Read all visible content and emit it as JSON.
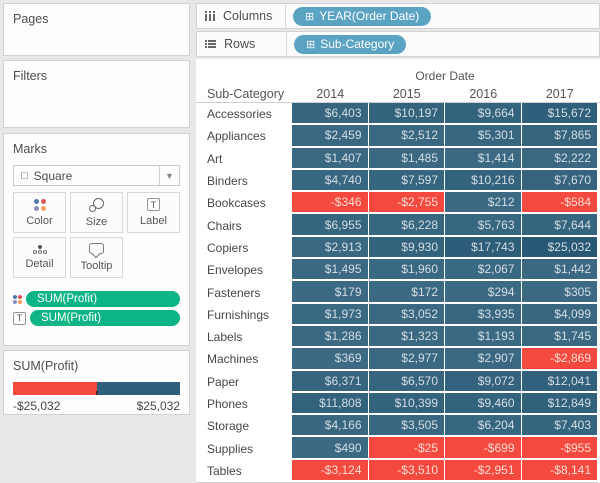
{
  "colors": {
    "pill_blue": "#5ba3c2",
    "pill_green": "#0db485",
    "cell_negative": "#f4493e",
    "cell_positive_low": "#3c6a84",
    "cell_positive_high": "#285875",
    "legend_red": "#f4493e",
    "legend_blue": "#2f5f7c"
  },
  "glyphs": {
    "square": "□",
    "caret": "▼",
    "field_plus": "⊞",
    "t": "T"
  },
  "shelves": {
    "columns_label": "Columns",
    "columns_pill": "YEAR(Order Date)",
    "rows_label": "Rows",
    "rows_pill": "Sub-Category"
  },
  "sidebar": {
    "pages_label": "Pages",
    "filters_label": "Filters",
    "marks": {
      "label": "Marks",
      "mark_type": "Square",
      "buttons": [
        "Color",
        "Size",
        "Label",
        "Detail",
        "Tooltip"
      ],
      "pills": [
        "SUM(Profit)",
        "SUM(Profit)"
      ]
    },
    "legend": {
      "title": "SUM(Profit)",
      "min_label": "-$25,032",
      "max_label": "$25,032"
    }
  },
  "chart_data": {
    "type": "heatmap",
    "title": "Order Date",
    "row_field": "Sub-Category",
    "columns": [
      "2014",
      "2015",
      "2016",
      "2017"
    ],
    "color_domain": [
      -25032,
      25032
    ],
    "legend_position": "left-bottom",
    "rows": [
      {
        "label": "Accessories",
        "values": [
          6403,
          10197,
          9664,
          15672
        ],
        "formatted": [
          "$6,403",
          "$10,197",
          "$9,664",
          "$15,672"
        ]
      },
      {
        "label": "Appliances",
        "values": [
          2459,
          2512,
          5301,
          7865
        ],
        "formatted": [
          "$2,459",
          "$2,512",
          "$5,301",
          "$7,865"
        ]
      },
      {
        "label": "Art",
        "values": [
          1407,
          1485,
          1414,
          2222
        ],
        "formatted": [
          "$1,407",
          "$1,485",
          "$1,414",
          "$2,222"
        ]
      },
      {
        "label": "Binders",
        "values": [
          4740,
          7597,
          10216,
          7670
        ],
        "formatted": [
          "$4,740",
          "$7,597",
          "$10,216",
          "$7,670"
        ]
      },
      {
        "label": "Bookcases",
        "values": [
          -346,
          -2755,
          212,
          -584
        ],
        "formatted": [
          "-$346",
          "-$2,755",
          "$212",
          "-$584"
        ]
      },
      {
        "label": "Chairs",
        "values": [
          6955,
          6228,
          5763,
          7644
        ],
        "formatted": [
          "$6,955",
          "$6,228",
          "$5,763",
          "$7,644"
        ]
      },
      {
        "label": "Copiers",
        "values": [
          2913,
          9930,
          17743,
          25032
        ],
        "formatted": [
          "$2,913",
          "$9,930",
          "$17,743",
          "$25,032"
        ]
      },
      {
        "label": "Envelopes",
        "values": [
          1495,
          1960,
          2067,
          1442
        ],
        "formatted": [
          "$1,495",
          "$1,960",
          "$2,067",
          "$1,442"
        ]
      },
      {
        "label": "Fasteners",
        "values": [
          179,
          172,
          294,
          305
        ],
        "formatted": [
          "$179",
          "$172",
          "$294",
          "$305"
        ]
      },
      {
        "label": "Furnishings",
        "values": [
          1973,
          3052,
          3935,
          4099
        ],
        "formatted": [
          "$1,973",
          "$3,052",
          "$3,935",
          "$4,099"
        ]
      },
      {
        "label": "Labels",
        "values": [
          1286,
          1323,
          1193,
          1745
        ],
        "formatted": [
          "$1,286",
          "$1,323",
          "$1,193",
          "$1,745"
        ]
      },
      {
        "label": "Machines",
        "values": [
          369,
          2977,
          2907,
          -2869
        ],
        "formatted": [
          "$369",
          "$2,977",
          "$2,907",
          "-$2,869"
        ]
      },
      {
        "label": "Paper",
        "values": [
          6371,
          6570,
          9072,
          12041
        ],
        "formatted": [
          "$6,371",
          "$6,570",
          "$9,072",
          "$12,041"
        ]
      },
      {
        "label": "Phones",
        "values": [
          11808,
          10399,
          9460,
          12849
        ],
        "formatted": [
          "$11,808",
          "$10,399",
          "$9,460",
          "$12,849"
        ]
      },
      {
        "label": "Storage",
        "values": [
          4166,
          3505,
          6204,
          7403
        ],
        "formatted": [
          "$4,166",
          "$3,505",
          "$6,204",
          "$7,403"
        ]
      },
      {
        "label": "Supplies",
        "values": [
          490,
          -25,
          -699,
          -955
        ],
        "formatted": [
          "$490",
          "-$25",
          "-$699",
          "-$955"
        ]
      },
      {
        "label": "Tables",
        "values": [
          -3124,
          -3510,
          -2951,
          -8141
        ],
        "formatted": [
          "-$3,124",
          "-$3,510",
          "-$2,951",
          "-$8,141"
        ]
      }
    ]
  }
}
